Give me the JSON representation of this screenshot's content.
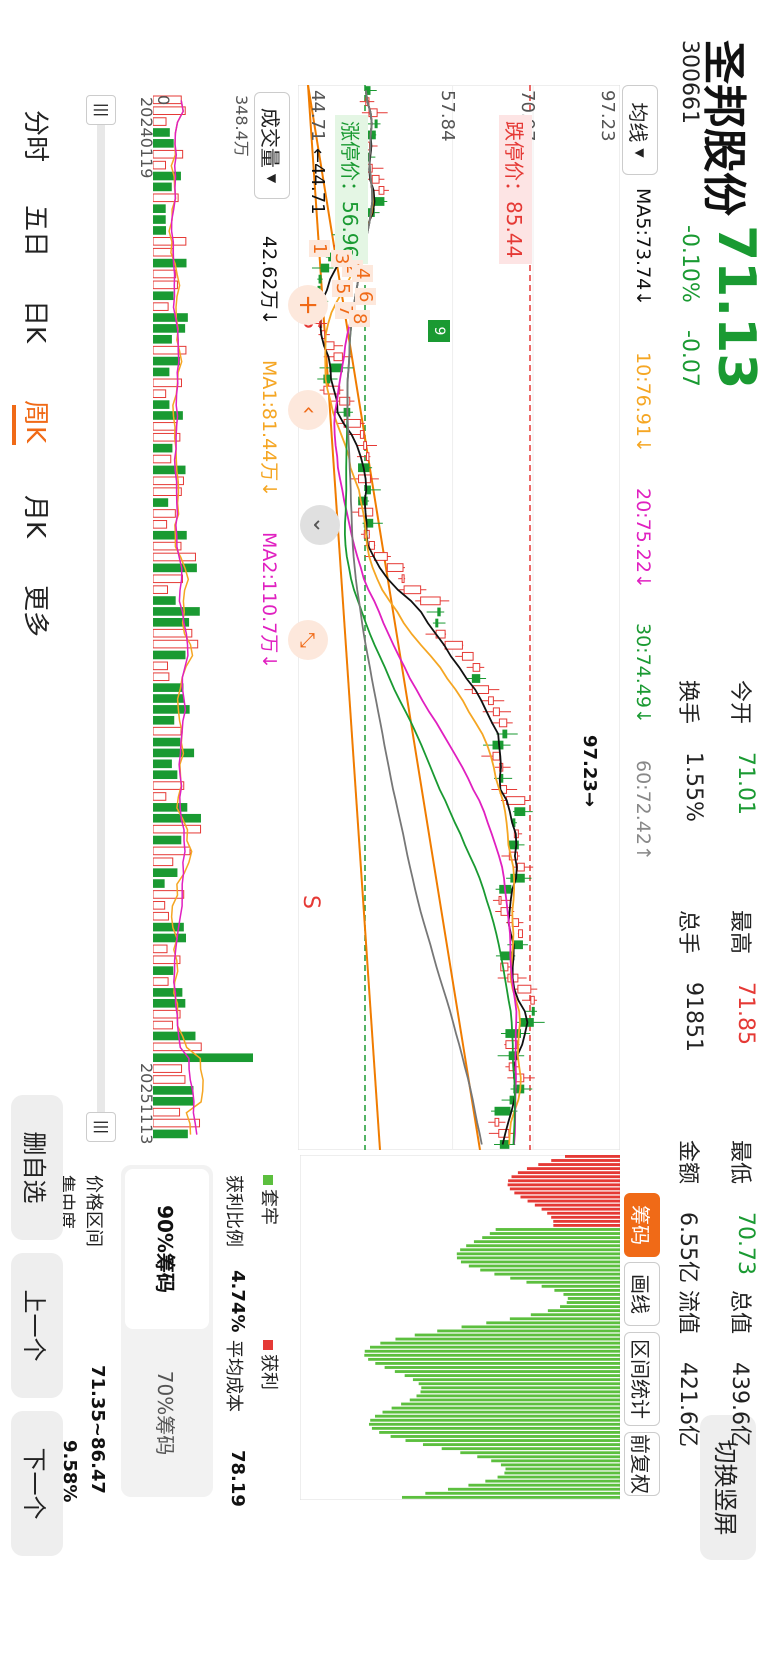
{
  "header": {
    "stock_name": "圣邦股份",
    "stock_code": "300661",
    "price": "71.13",
    "change_pct": "-0.10%",
    "change_amt": "-0.07",
    "switch_btn": "切换竖屏"
  },
  "stats": [
    {
      "label": "今开",
      "value": "71.01",
      "color": "green"
    },
    {
      "label": "最高",
      "value": "71.85",
      "color": "red"
    },
    {
      "label": "最低",
      "value": "70.73",
      "color": "green"
    },
    {
      "label": "总值",
      "value": "439.6亿",
      "color": "black"
    },
    {
      "label": "换手",
      "value": "1.55%",
      "color": "black"
    },
    {
      "label": "总手",
      "value": "91851",
      "color": "black"
    },
    {
      "label": "金额",
      "value": "6.55亿",
      "color": "black"
    },
    {
      "label": "流值",
      "value": "421.6亿",
      "color": "black"
    }
  ],
  "ma_legend": {
    "selector": "均线",
    "ma5": "MA5:73.74↓",
    "ma10": "10:76.91↓",
    "ma20": "20:75.22↓",
    "ma30": "30:74.49↓",
    "ma60": "60:72.42↑"
  },
  "main_chart": {
    "axis_top": "97.23",
    "axis_line2": "70.97",
    "axis_line3": "57.84",
    "axis_bottom": "44.71",
    "limit_down": "跌停价：85.44",
    "limit_up": "涨停价：56.96",
    "low_marker": "←44.71",
    "high_marker": "97.23→",
    "wave_labels": [
      "1",
      "2",
      "3",
      "4",
      "5",
      "6",
      "7",
      "8"
    ],
    "wave_label_9": "9",
    "signal_s": "S"
  },
  "volume": {
    "selector": "成交量",
    "volume": "42.62万↓",
    "ma1": "MA1:81.44万↓",
    "ma2": "MA2:110.7万↓",
    "axis_top": "348.4万",
    "axis_bottom": "0",
    "date_start": "20240119",
    "date_end": "20251113"
  },
  "right_panel": {
    "tabs": [
      "筹码",
      "画线",
      "区间统计",
      "前复权"
    ],
    "legend_trapped": "套牢",
    "legend_profit": "获利",
    "profit_ratio_label": "获利比例",
    "profit_ratio_value": "4.74%",
    "avg_cost_label": "平均成本",
    "avg_cost_value": "78.19",
    "chip_tabs": [
      "90%筹码",
      "70%筹码"
    ],
    "range_label": "价格区间",
    "range_value": "71.35~86.47",
    "conc_label": "集中度",
    "conc_value": "9.58%"
  },
  "bottom_nav": {
    "tabs": [
      "分时",
      "五日",
      "日K",
      "周K",
      "月K",
      "更多"
    ],
    "active": "周K",
    "buttons": [
      "删自选",
      "上一个",
      "下一个"
    ]
  },
  "colors": {
    "up": "#e53935",
    "down": "#1a9a32",
    "accent": "#f06a17",
    "ma5": "#111111",
    "ma10": "#f5a623",
    "ma20": "#e020c0",
    "ma30": "#1a9a32",
    "ma60": "#777777"
  }
}
